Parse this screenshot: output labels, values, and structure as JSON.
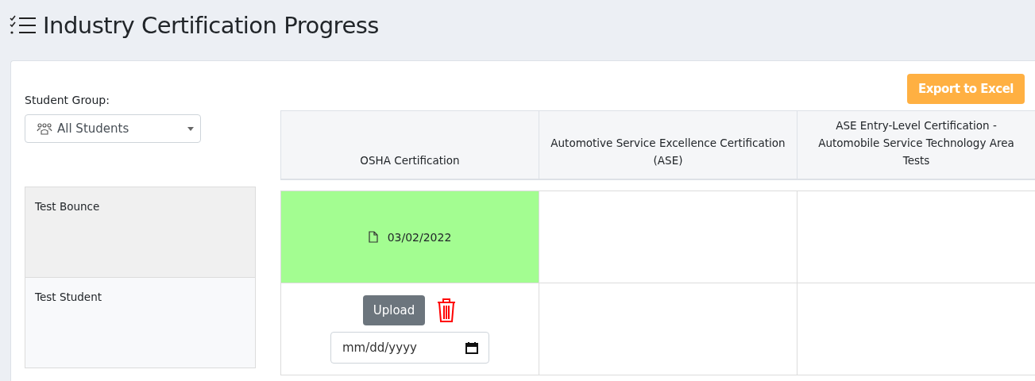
{
  "page": {
    "title": "Industry Certification Progress"
  },
  "toolbar": {
    "export_button": "Export to Excel"
  },
  "filter": {
    "label": "Student Group:",
    "value": "All Students"
  },
  "table": {
    "columns": [
      "OSHA Certification",
      "Automotive Service Excellence Certification (ASE)",
      "ASE Entry-Level Certification - Automobile Service Technology Area Tests"
    ],
    "rows": [
      {
        "student": "Test Bounce",
        "cells": [
          {
            "kind": "completed",
            "date": "03/02/2022"
          },
          {
            "kind": "empty"
          },
          {
            "kind": "empty"
          }
        ]
      },
      {
        "student": "Test Student",
        "cells": [
          {
            "kind": "upload",
            "button": "Upload",
            "placeholder": "mm/dd/yyyy"
          },
          {
            "kind": "empty"
          },
          {
            "kind": "empty"
          }
        ]
      }
    ]
  }
}
